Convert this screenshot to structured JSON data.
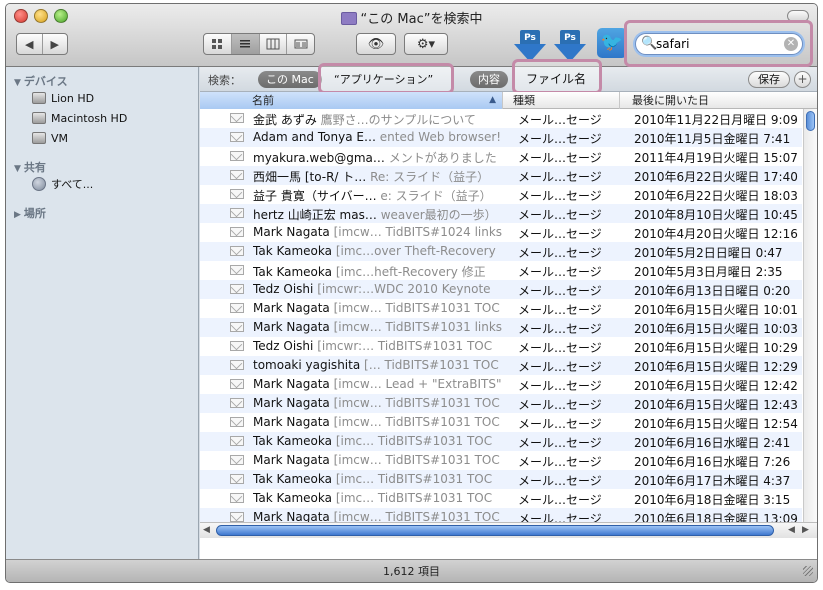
{
  "window": {
    "title": "“この Mac”を検索中"
  },
  "toolbar": {
    "back_icon": "◀",
    "forward_icon": "▶",
    "view_icon": "👁",
    "action_icon": "⚙▾",
    "ps_label": "Ps",
    "twitter_icon": "🐦"
  },
  "search": {
    "value": "safari",
    "clear_icon": "✕",
    "icon": "🔍"
  },
  "sidebar": {
    "devices_header": "デバイス",
    "devices": [
      "Lion HD",
      "Macintosh HD",
      "VM"
    ],
    "shared_header": "共有",
    "shared": [
      "すべて..."
    ],
    "places_header": "場所"
  },
  "scope": {
    "label": "検索：",
    "this_mac": "この Mac",
    "applications": "“アプリケーション”",
    "contents": "内容",
    "filename": "ファイル名",
    "save": "保存",
    "plus": "+"
  },
  "columns": {
    "name": "名前",
    "kind": "種類",
    "last_opened": "最後に開いた日"
  },
  "rows": [
    {
      "name": "金武 あずみ",
      "sub": "鷹野さ…のサンプルについて",
      "kind": "メール…セージ",
      "date": "2010年11月22日月曜日 9:09"
    },
    {
      "name": "Adam and Tonya E…",
      "sub": "ented Web browser!",
      "kind": "メール…セージ",
      "date": "2010年11月5日金曜日 7:41"
    },
    {
      "name": "myakura.web@gma…",
      "sub": "メントがありました",
      "kind": "メール…セージ",
      "date": "2011年4月19日火曜日 15:07"
    },
    {
      "name": "西畑一馬 [to-R/ ト…",
      "sub": "Re: スライド（益子）",
      "kind": "メール…セージ",
      "date": "2010年6月22日火曜日 17:40"
    },
    {
      "name": "益子 貴寛（サイバー…",
      "sub": "e: スライド（益子）",
      "kind": "メール…セージ",
      "date": "2010年6月22日火曜日 18:03"
    },
    {
      "name": "hertz 山崎正宏 mas…",
      "sub": "weaver最初の一歩）",
      "kind": "メール…セージ",
      "date": "2010年8月10日火曜日 10:45"
    },
    {
      "name": "Mark Nagata",
      "sub": "[imcw… TidBITS#1024 links",
      "kind": "メール…セージ",
      "date": "2010年4月20日火曜日 12:16"
    },
    {
      "name": "Tak Kameoka",
      "sub": "[imc…over Theft-Recovery",
      "kind": "メール…セージ",
      "date": "2010年5月2日日曜日 0:47"
    },
    {
      "name": "Tak Kameoka",
      "sub": "[imc…heft-Recovery 修正",
      "kind": "メール…セージ",
      "date": "2010年5月3日月曜日 2:35"
    },
    {
      "name": "Tedz Oishi",
      "sub": "[imcwr:…WDC 2010 Keynote",
      "kind": "メール…セージ",
      "date": "2010年6月13日日曜日 0:20"
    },
    {
      "name": "Mark Nagata",
      "sub": "[imcw… TidBITS#1031 TOC",
      "kind": "メール…セージ",
      "date": "2010年6月15日火曜日 10:01"
    },
    {
      "name": "Mark Nagata",
      "sub": "[imcw… TidBITS#1031 links",
      "kind": "メール…セージ",
      "date": "2010年6月15日火曜日 10:03"
    },
    {
      "name": "Tedz Oishi",
      "sub": "[imcwr:… TidBITS#1031 TOC",
      "kind": "メール…セージ",
      "date": "2010年6月15日火曜日 10:29"
    },
    {
      "name": "tomoaki yagishita",
      "sub": "[… TidBITS#1031 TOC",
      "kind": "メール…セージ",
      "date": "2010年6月15日火曜日 12:29"
    },
    {
      "name": "Mark Nagata",
      "sub": "[imcw… Lead + \"ExtraBITS\"",
      "kind": "メール…セージ",
      "date": "2010年6月15日火曜日 12:42"
    },
    {
      "name": "Mark Nagata",
      "sub": "[imcw… TidBITS#1031 TOC",
      "kind": "メール…セージ",
      "date": "2010年6月15日火曜日 12:43"
    },
    {
      "name": "Mark Nagata",
      "sub": "[imcw… TidBITS#1031 TOC",
      "kind": "メール…セージ",
      "date": "2010年6月15日火曜日 12:54"
    },
    {
      "name": "Tak Kameoka",
      "sub": "[imc… TidBITS#1031 TOC",
      "kind": "メール…セージ",
      "date": "2010年6月16日水曜日 2:41"
    },
    {
      "name": "Mark Nagata",
      "sub": "[imcw… TidBITS#1031 TOC",
      "kind": "メール…セージ",
      "date": "2010年6月16日水曜日 7:26"
    },
    {
      "name": "Tak Kameoka",
      "sub": "[imc… TidBITS#1031 TOC",
      "kind": "メール…セージ",
      "date": "2010年6月17日木曜日 4:37"
    },
    {
      "name": "Tak Kameoka",
      "sub": "[imc… TidBITS#1031 TOC",
      "kind": "メール…セージ",
      "date": "2010年6月18日金曜日 3:15"
    },
    {
      "name": "Mark Nagata",
      "sub": "[imcw… TidBITS#1031 TOC",
      "kind": "メール…セージ",
      "date": "2010年6月18日金曜日 13:09"
    }
  ],
  "status": {
    "count": "1,612 項目"
  }
}
